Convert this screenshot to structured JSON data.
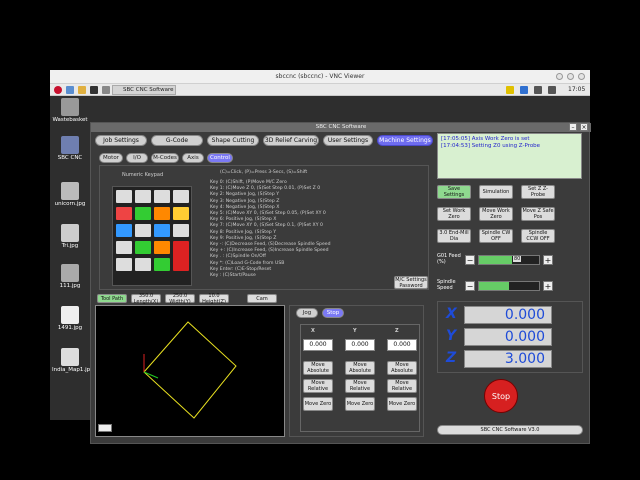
{
  "window": {
    "title": "sbccnc (sbccnc) - VNC Viewer"
  },
  "taskbar": {
    "item": "SBC CNC Software",
    "clock": "17:05"
  },
  "desktop_icons": [
    {
      "label": "Wastebasket"
    },
    {
      "label": "SBC CNC"
    },
    {
      "label": "unicorn.jpg"
    },
    {
      "label": "Tri.jpg"
    },
    {
      "label": "111.jpg"
    },
    {
      "label": "1491.jpg"
    },
    {
      "label": "India_Map1.jpg"
    }
  ],
  "app": {
    "title": "SBC CNC Software",
    "tabs": [
      "Job Settings",
      "G-Code",
      "Shape Cutting",
      "3D Relief Carving",
      "User Settings",
      "Machine Settings"
    ],
    "subtabs": [
      "Motor",
      "I/O",
      "M-Codes",
      "Axis",
      "Control"
    ],
    "keypad_title": "Numeric Keypad",
    "help_header": "(C)=Click, (P)=Press 3-Secs, (S)=Shift",
    "help_lines": [
      "Key 0: (C)Shift, (P)Move M/C Zero",
      "Key 1: (C)Move Z 0, (S)Set Step 0.01, (P)Set Z 0",
      "Key 2: Negative Jog, (S)Step Y",
      "Key 3: Negative Jog, (S)Step Z",
      "Key 4: Negative Jog, (S)Step X",
      "Key 5: (C)Move XY 0, (S)Set Step 0.05, (P)Set XY 0",
      "Key 6: Positive Jog, (S)Step X",
      "Key 7: (C)Move XY 0, (S)Set Step 0.1, (P)Set XY 0",
      "Key 8: Positive Jog, (S)Step Y",
      "Key 9: Positive Jog, (S)Step Z",
      "Key -: (C)Decrease Feed, (S)Decrease Spindle Speed",
      "Key +: (C)Increase Feed, (S)Increase Spindle Speed",
      "Key . : (C)Spindle On/Off",
      "Key *: (C)Load G-Code from USB",
      "Key Enter: (C)E-Stop/Reset",
      "Key   : (C)Start/Pause"
    ],
    "mc_settings_password": "M/C Settings Password",
    "plot_header": {
      "tool_path": "Tool Path",
      "length": "350.0 Length(X)",
      "width": "250.0 Width(Y)",
      "height": "10.0 Height(Z)",
      "cam": "Cam"
    },
    "jog": {
      "jog_label": "Jog",
      "stop_label": "Stop",
      "axes": [
        "X",
        "Y",
        "Z"
      ],
      "values": [
        "0.000",
        "0.000",
        "0.000"
      ],
      "move_absolute": "Move Absolute",
      "move_relative": "Move Relative",
      "move_zero": "Move Zero"
    },
    "status_lines": [
      "[17:05:05] Axis Work Zero is set",
      "[17:04:53] Setting Z0 using Z-Probe"
    ],
    "buttons": {
      "save_settings": "Save Settings",
      "simulation": "Simulation",
      "set_z_probe": "Set Z Z-Probe",
      "set_work_zero": "Set Work Zero",
      "move_work_zero": "Move Work Zero",
      "move_z_safe": "Move Z Safe Pos",
      "end_mill": "3.0 End-Mill Dia",
      "spindle_cw": "Spindle CW OFF",
      "spindle_ccw": "Spindle CCW OFF"
    },
    "feed": {
      "label": "G01 Feed (%)",
      "value": "80",
      "level": 0.55
    },
    "spindle": {
      "label": "Spindle Speed",
      "level": 0.5
    },
    "coords": {
      "x_label": "X",
      "y_label": "Y",
      "z_label": "Z",
      "x": "0.000",
      "y": "0.000",
      "z": "3.000"
    },
    "stop_label": "Stop",
    "version": "SBC CNC Software V3.0"
  }
}
